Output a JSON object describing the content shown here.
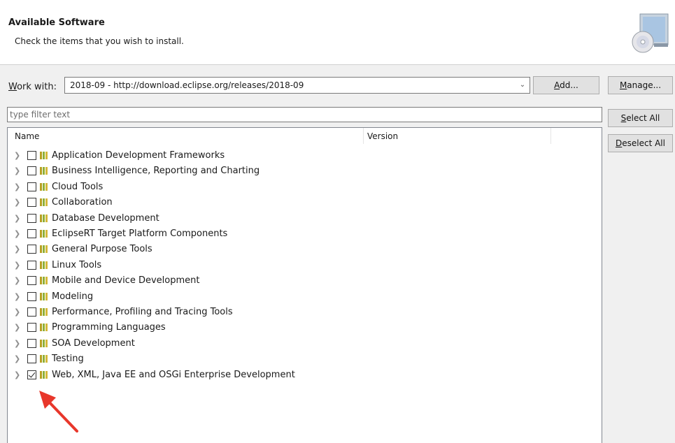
{
  "header": {
    "title": "Available Software",
    "subtitle": "Check the items that you wish to install."
  },
  "work_with": {
    "label_mnemonic": "W",
    "label_rest": "ork with:",
    "value": "2018-09 - http://download.eclipse.org/releases/2018-09"
  },
  "buttons": {
    "add_mnemonic": "A",
    "add_rest": "dd...",
    "manage_mnemonic": "M",
    "manage_rest": "anage...",
    "select_all_mnemonic": "S",
    "select_all_rest": "elect All",
    "deselect_all_mnemonic": "D",
    "deselect_all_rest": "eselect All"
  },
  "filter": {
    "placeholder": "type filter text"
  },
  "table": {
    "columns": [
      "Name",
      "Version"
    ],
    "items": [
      {
        "label": "Application Development Frameworks",
        "checked": false
      },
      {
        "label": "Business Intelligence, Reporting and Charting",
        "checked": false
      },
      {
        "label": "Cloud Tools",
        "checked": false
      },
      {
        "label": "Collaboration",
        "checked": false
      },
      {
        "label": "Database Development",
        "checked": false
      },
      {
        "label": "EclipseRT Target Platform Components",
        "checked": false
      },
      {
        "label": "General Purpose Tools",
        "checked": false
      },
      {
        "label": "Linux Tools",
        "checked": false
      },
      {
        "label": "Mobile and Device Development",
        "checked": false
      },
      {
        "label": "Modeling",
        "checked": false
      },
      {
        "label": "Performance, Profiling and Tracing Tools",
        "checked": false
      },
      {
        "label": "Programming Languages",
        "checked": false
      },
      {
        "label": "SOA Development",
        "checked": false
      },
      {
        "label": "Testing",
        "checked": false
      },
      {
        "label": "Web, XML, Java EE and OSGi Enterprise Development",
        "checked": true
      }
    ]
  },
  "colors": {
    "annotation_arrow": "#e8372b"
  }
}
